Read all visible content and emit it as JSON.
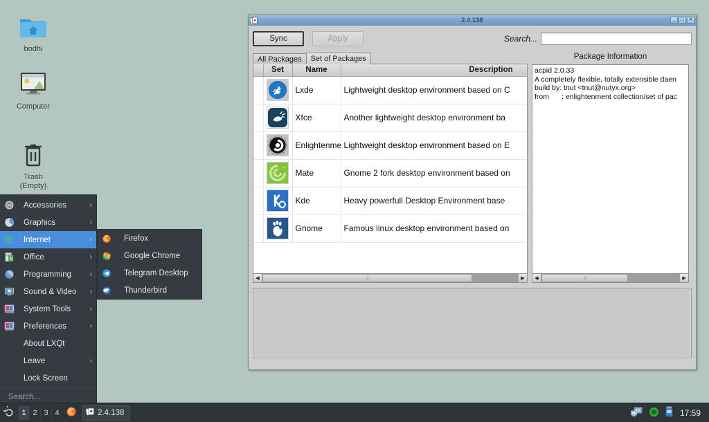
{
  "desktop": {
    "icons": [
      {
        "label": "bodhi",
        "icon": "home-folder-icon"
      },
      {
        "label": "Computer",
        "icon": "computer-icon"
      },
      {
        "label": "Trash\n(Empty)",
        "label_line1": "Trash",
        "label_line2": "(Empty)",
        "icon": "trash-icon"
      }
    ]
  },
  "main_menu": {
    "items": [
      {
        "label": "Accessories",
        "icon": "accessories-icon",
        "arrow": "›",
        "selected": false
      },
      {
        "label": "Graphics",
        "icon": "graphics-icon",
        "arrow": "›",
        "selected": false
      },
      {
        "label": "Internet",
        "icon": "internet-icon",
        "arrow": "›",
        "selected": true
      },
      {
        "label": "Office",
        "icon": "office-icon",
        "arrow": "›",
        "selected": false
      },
      {
        "label": "Programming",
        "icon": "programming-icon",
        "arrow": "›",
        "selected": false
      },
      {
        "label": "Sound & Video",
        "icon": "sound-video-icon",
        "arrow": "›",
        "selected": false
      },
      {
        "label": "System Tools",
        "icon": "system-tools-icon",
        "arrow": "›",
        "selected": false
      },
      {
        "label": "Preferences",
        "icon": "preferences-icon",
        "arrow": "›",
        "selected": false
      },
      {
        "label": "About LXQt",
        "icon": "",
        "arrow": "",
        "selected": false
      },
      {
        "label": "Leave",
        "icon": "",
        "arrow": "›",
        "selected": false
      },
      {
        "label": "Lock Screen",
        "icon": "",
        "arrow": "",
        "selected": false
      }
    ],
    "search_placeholder": "Search..."
  },
  "submenu": {
    "parent": "Internet",
    "items": [
      {
        "label": "Firefox",
        "icon": "firefox-icon"
      },
      {
        "label": "Google Chrome",
        "icon": "chrome-icon"
      },
      {
        "label": "Telegram Desktop",
        "icon": "telegram-icon"
      },
      {
        "label": "Thunderbird",
        "icon": "thunderbird-icon"
      }
    ]
  },
  "window": {
    "title": "2.4.138",
    "icon": "cards-icon",
    "controls": {
      "minimize": "_",
      "maximize": "□",
      "close": "✕"
    },
    "toolbar": {
      "sync_label": "Sync",
      "apply_label": "Apply",
      "apply_disabled": true,
      "search_label": "Search...",
      "search_value": "",
      "search_placeholder": ""
    },
    "tabs": [
      {
        "label": "All Packages",
        "active": false
      },
      {
        "label": "Set of Packages",
        "active": true
      }
    ],
    "table": {
      "columns": [
        "",
        "Set",
        "Name",
        "Description"
      ],
      "rows": [
        {
          "checked": false,
          "set_icon": "lxde-icon",
          "name": "Lxde",
          "description": "Lightweight desktop environment based on C"
        },
        {
          "checked": false,
          "set_icon": "xfce-icon",
          "name": "Xfce",
          "description": "Another lightweight desktop environment ba"
        },
        {
          "checked": false,
          "set_icon": "enlightenment-icon",
          "name": "Enlightenment",
          "description": "Lightweight desktop environment based on E"
        },
        {
          "checked": false,
          "set_icon": "mate-icon",
          "name": "Mate",
          "description": "Gnome 2 fork desktop environment based on"
        },
        {
          "checked": false,
          "set_icon": "kde-icon",
          "name": "Kde",
          "description": "Heavy powerfull Desktop Environment base"
        },
        {
          "checked": false,
          "set_icon": "gnome-icon",
          "name": "Gnome",
          "description": "Famous linux desktop environment based on"
        }
      ]
    },
    "package_information": {
      "title": "Package Information",
      "lines": [
        "acpid 2.0.33",
        "A completely flexible, totally extensible daen",
        "build by: tnut <tnut@nutyx.org>",
        "from     : enlightenment collection/set of pac"
      ]
    },
    "log_panel": {
      "text": ""
    },
    "scrollbars": {
      "table_h": {
        "left_arrow": "◀",
        "right_arrow": "▶",
        "thumb_pct": 82
      },
      "info_h": {
        "left_arrow": "◀",
        "right_arrow": "▶",
        "thumb_pct": 63
      }
    }
  },
  "taskbar": {
    "menu_icon": "lxqt-menu-icon",
    "workspaces": [
      {
        "label": "1",
        "active": true
      },
      {
        "label": "2",
        "active": false
      },
      {
        "label": "3",
        "active": false
      },
      {
        "label": "4",
        "active": false
      }
    ],
    "quicklaunch": [
      {
        "icon": "firefox-icon",
        "label": "Firefox"
      }
    ],
    "tasks": [
      {
        "label": "2.4.138",
        "icon": "cards-icon"
      }
    ],
    "tray": [
      {
        "icon": "network-monitor-icon"
      },
      {
        "icon": "green-orb-icon"
      },
      {
        "icon": "usb-drive-icon"
      }
    ],
    "clock": "17:59"
  },
  "colors": {
    "desktop_bg": "#b3c6bf",
    "menu_bg": "#353b40",
    "menu_highlight": "#4a8ddc",
    "taskbar_bg": "#2e3338",
    "titlebar": "#7ea6cd",
    "window_bg": "#cfcfcf"
  }
}
